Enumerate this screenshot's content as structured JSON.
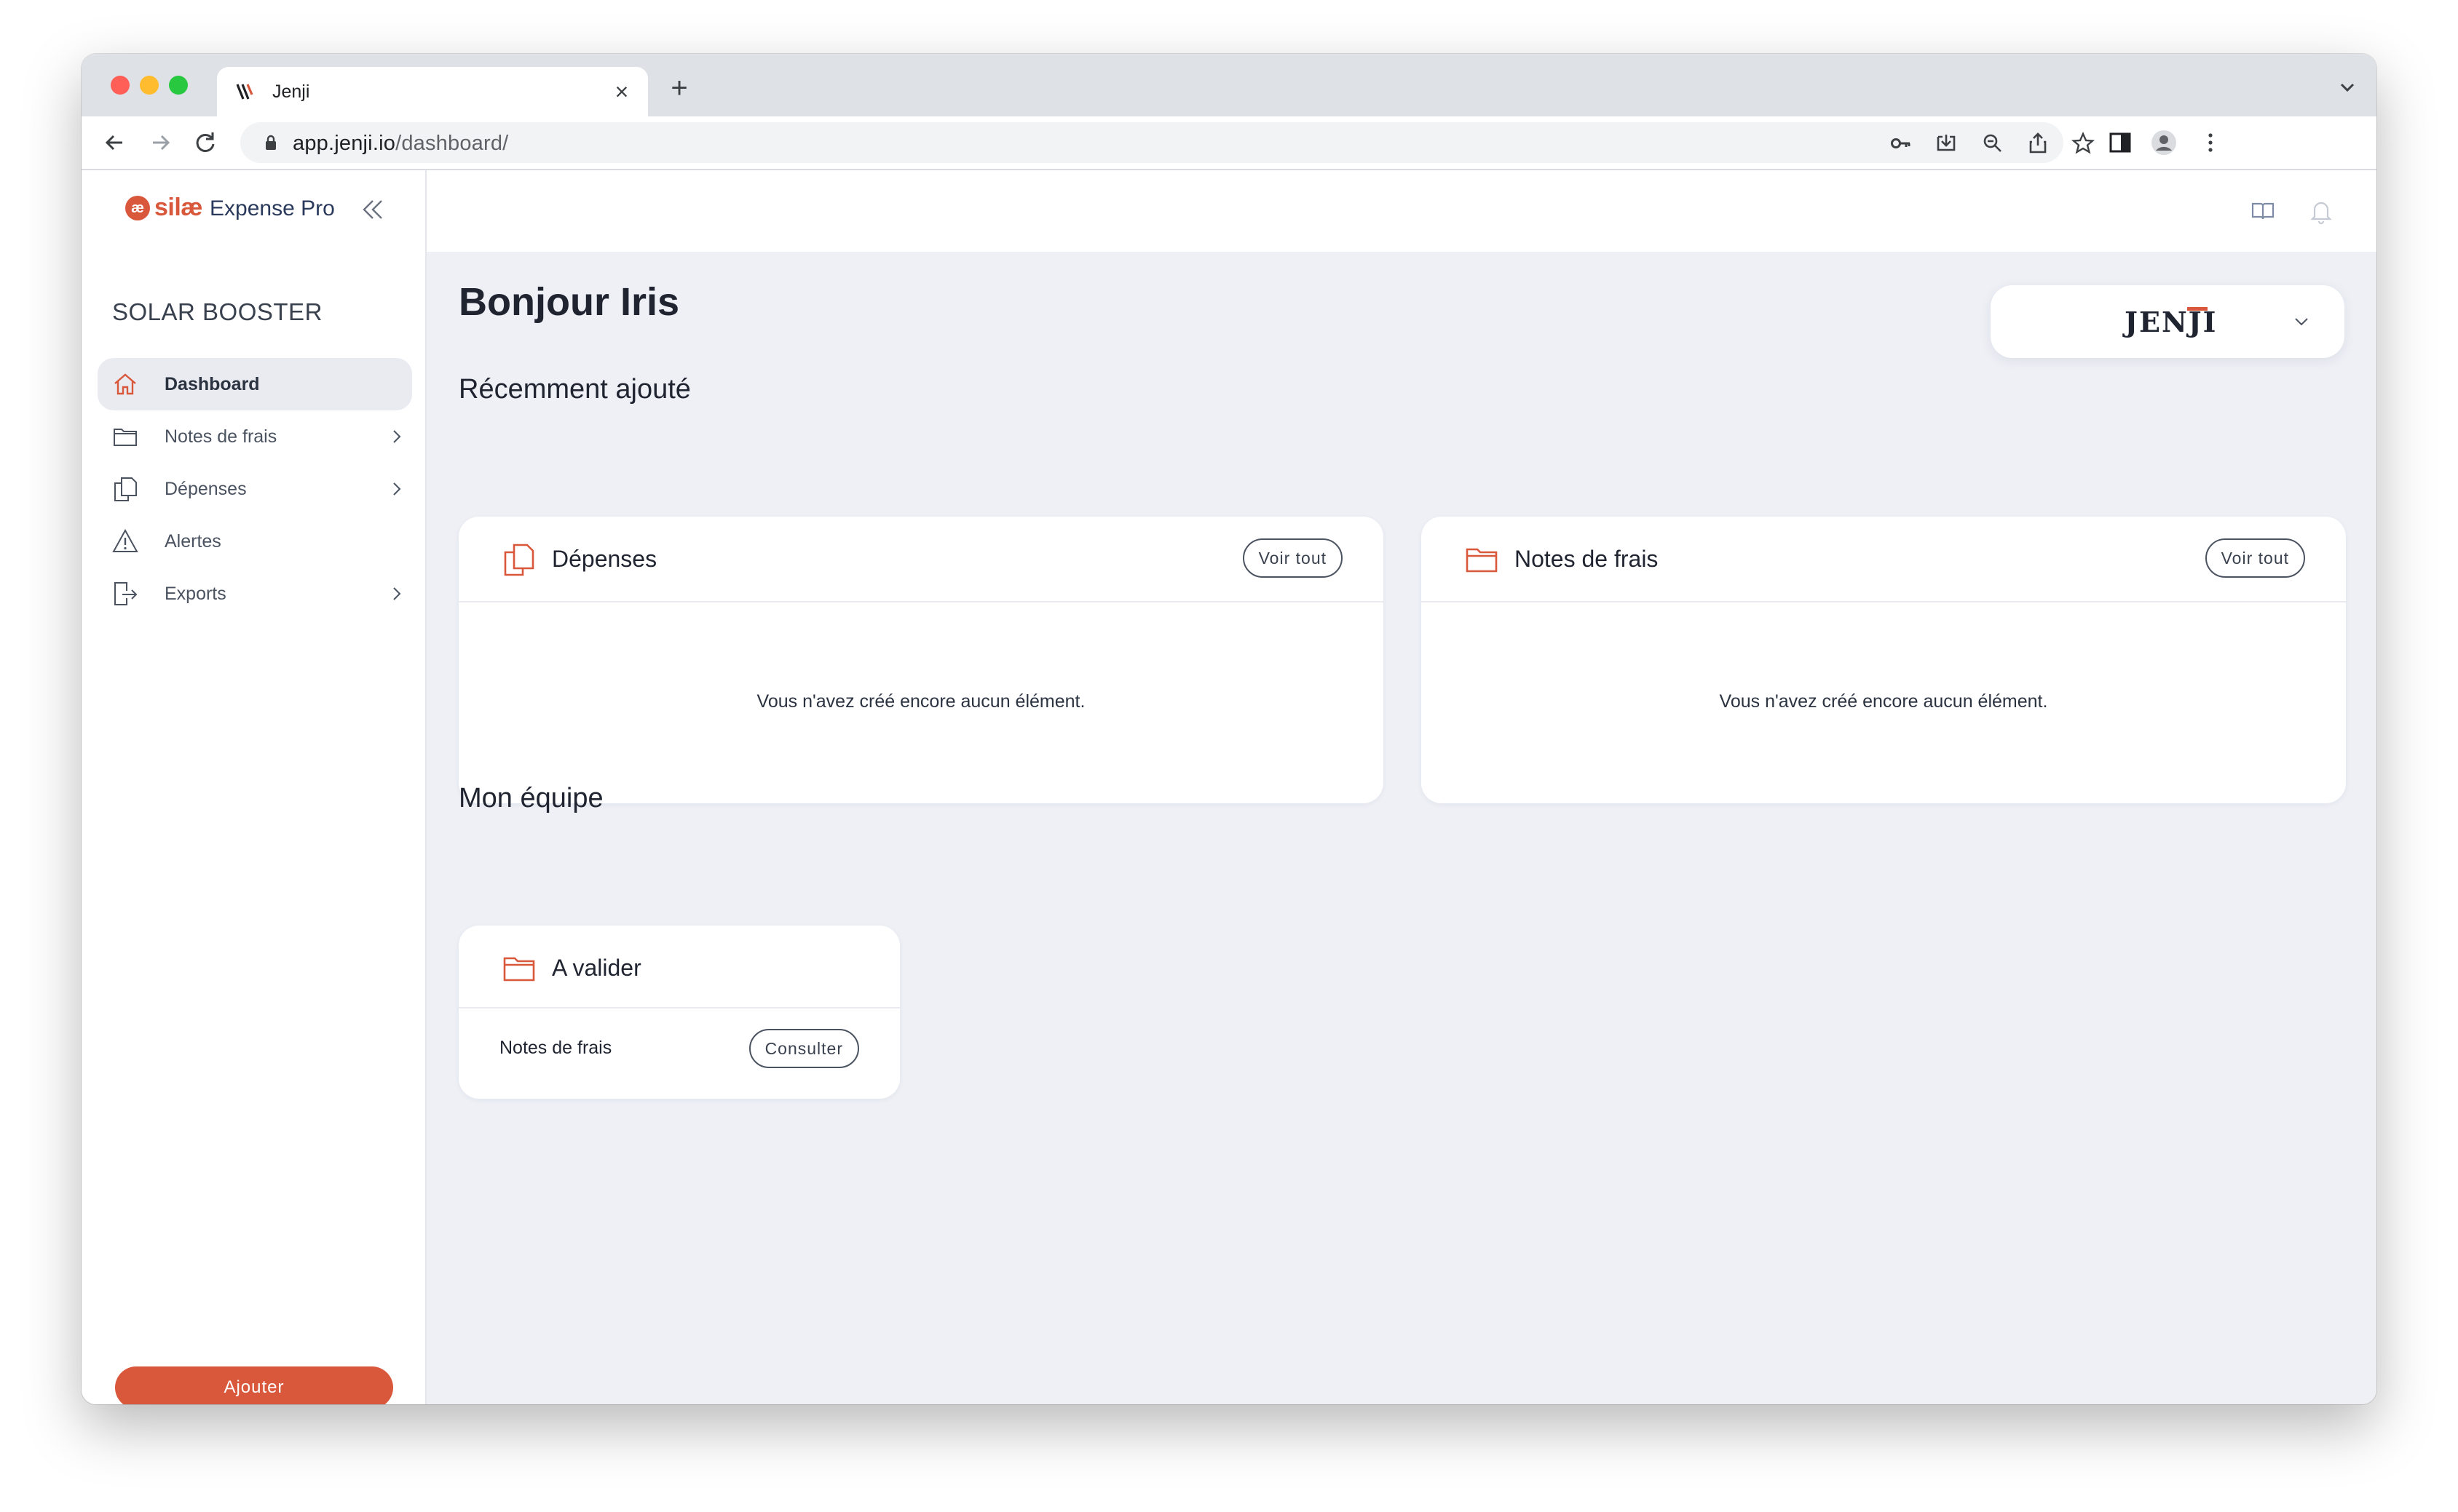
{
  "browser": {
    "tab_title": "Jenji",
    "tab_close": "×",
    "new_tab": "+",
    "url_host": "app.jenji.io",
    "url_path": "/dashboard/"
  },
  "brand": {
    "mark": "æ",
    "name": "silæ",
    "product": "Expense Pro"
  },
  "sidebar": {
    "company": "SOLAR BOOSTER",
    "items": [
      {
        "label": "Dashboard",
        "icon": "home-icon",
        "active": true,
        "has_children": false
      },
      {
        "label": "Notes de frais",
        "icon": "folder-icon",
        "active": false,
        "has_children": true
      },
      {
        "label": "Dépenses",
        "icon": "copy-icon",
        "active": false,
        "has_children": true
      },
      {
        "label": "Alertes",
        "icon": "warning-icon",
        "active": false,
        "has_children": false
      },
      {
        "label": "Exports",
        "icon": "export-icon",
        "active": false,
        "has_children": true
      }
    ],
    "add_label": "Ajouter"
  },
  "main": {
    "greeting": "Bonjour Iris",
    "company_selector": "JENJI",
    "recent_title": "Récemment ajouté",
    "cards": [
      {
        "title": "Dépenses",
        "icon": "copy-icon",
        "button": "Voir tout",
        "empty": "Vous n'avez créé encore aucun élément."
      },
      {
        "title": "Notes de frais",
        "icon": "folder-icon",
        "button": "Voir tout",
        "empty": "Vous n'avez créé encore aucun élément."
      }
    ],
    "team_title": "Mon équipe",
    "team_card": {
      "title": "A valider",
      "icon": "folder-icon",
      "row_label": "Notes de frais",
      "button": "Consulter"
    }
  },
  "colors": {
    "accent": "#d9573b",
    "background": "#eef0f6",
    "text": "#1f2430"
  }
}
